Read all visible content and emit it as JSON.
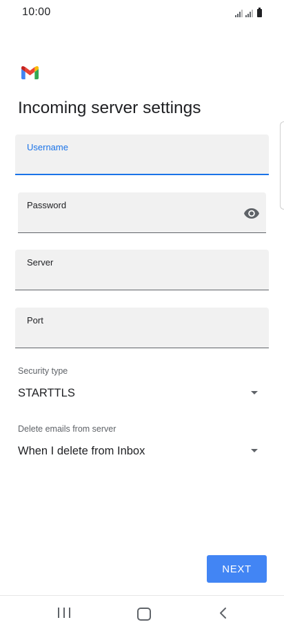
{
  "status_bar": {
    "time": "10:00",
    "icons": [
      "signal-icon",
      "signal-icon",
      "battery-icon"
    ]
  },
  "app": {
    "logo": "gmail-logo",
    "title": "Incoming server settings"
  },
  "form": {
    "username": {
      "label": "Username",
      "value": ""
    },
    "password": {
      "label": "Password",
      "value": "",
      "toggle_icon": "eye-icon"
    },
    "server": {
      "label": "Server",
      "value": ""
    },
    "port": {
      "label": "Port",
      "value": ""
    },
    "security_type": {
      "label": "Security type",
      "value": "STARTTLS"
    },
    "delete_emails": {
      "label": "Delete emails from server",
      "value": "When I delete from Inbox"
    }
  },
  "actions": {
    "next_label": "NEXT"
  },
  "nav_bar": {
    "icons": [
      "recents-icon",
      "home-icon",
      "back-icon"
    ]
  },
  "colors": {
    "accent": "#1a73e8",
    "button": "#4285f4",
    "field_background": "#f1f1f1",
    "text": "#202124",
    "secondary_text": "#5f6368"
  }
}
